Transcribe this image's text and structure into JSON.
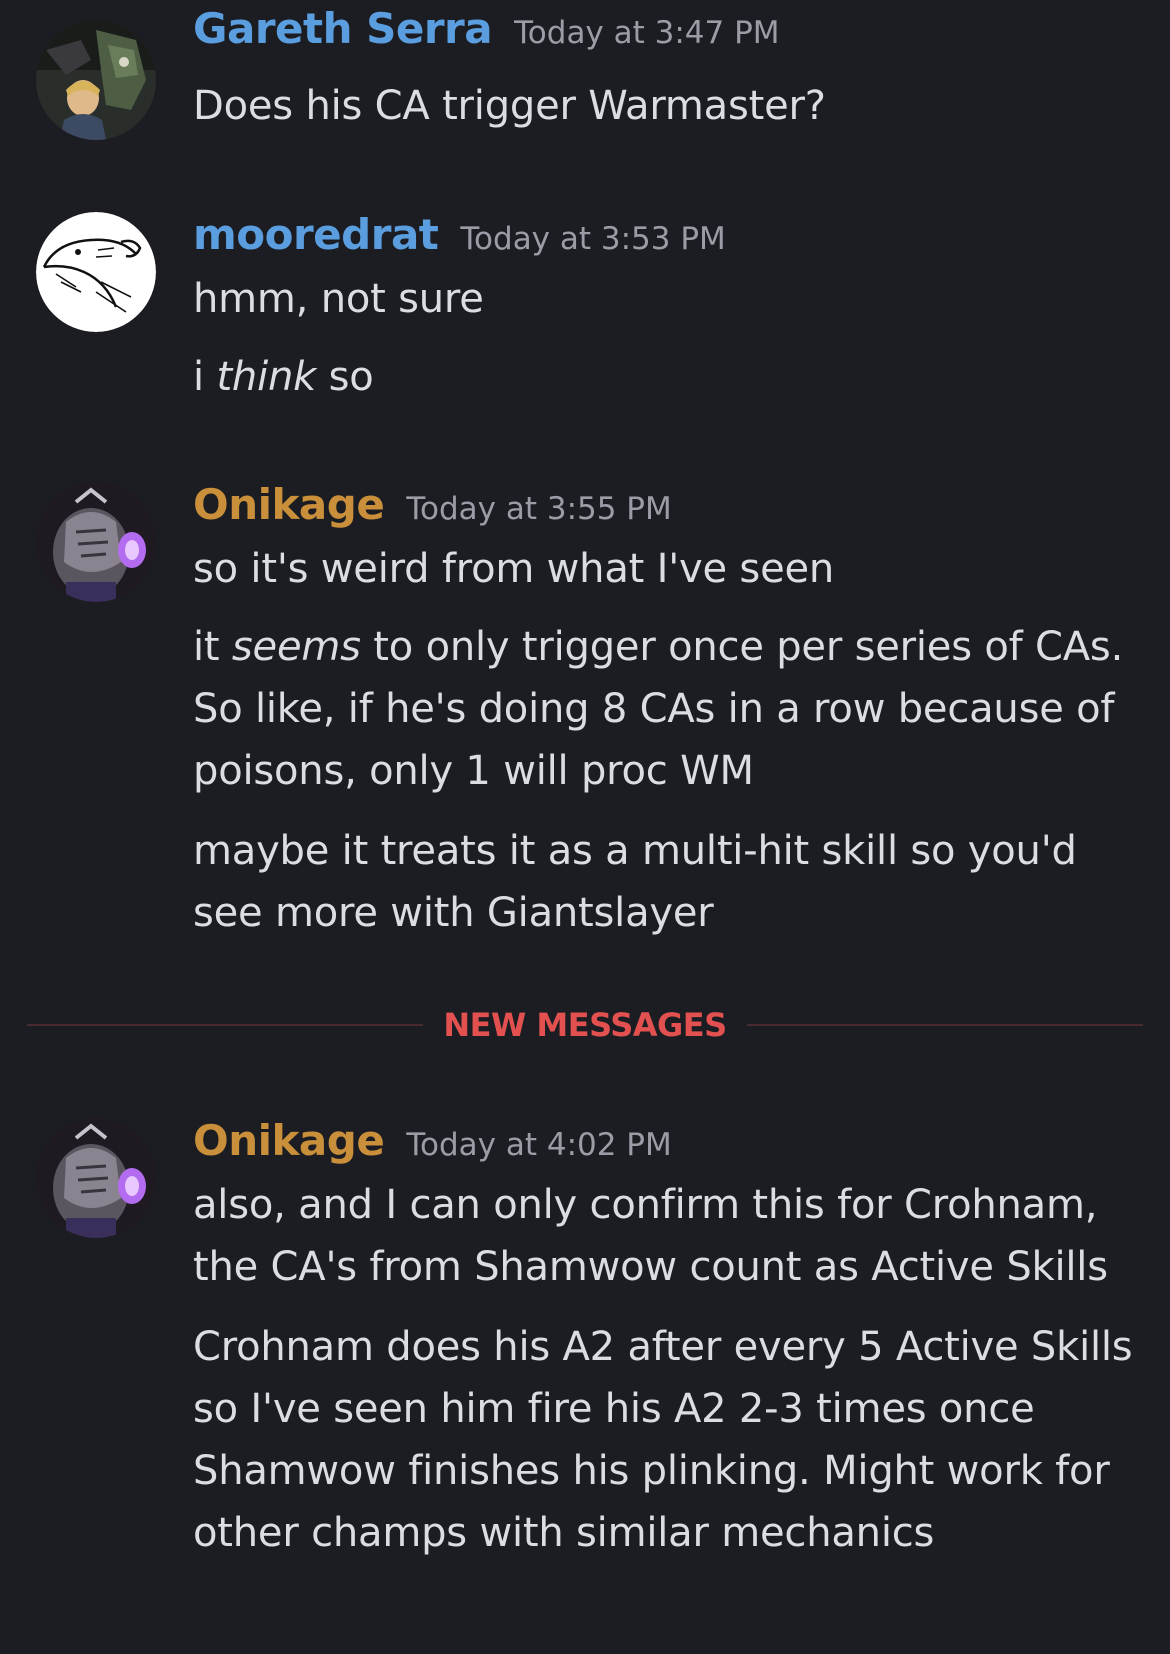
{
  "colors": {
    "background": "#1c1d22",
    "text": "#dbdee1",
    "timestamp": "#9a9da6",
    "new_messages": "#e2514f"
  },
  "messages": [
    {
      "username": "Gareth Serra",
      "username_color": "#5a9ee0",
      "timestamp": "Today at 3:47 PM",
      "avatar_icon": "mecha-avatar",
      "lines": [
        "Does his CA trigger Warmaster?"
      ]
    },
    {
      "username": "mooredrat",
      "username_color": "#5a9ee0",
      "timestamp": "Today at 3:53 PM",
      "avatar_icon": "rat-sketch-avatar",
      "lines": [
        "hmm, not sure",
        {
          "pre": "i ",
          "em": "think",
          "post": " so"
        }
      ]
    },
    {
      "username": "Onikage",
      "username_color": "#c98f3a",
      "timestamp": "Today at 3:55 PM",
      "avatar_icon": "warrior-avatar",
      "lines": [
        "so it's weird from what I've seen",
        {
          "pre": "it ",
          "em": "seems",
          "post": " to only trigger once per series of CAs. So like, if he's doing 8 CAs in a row because of poisons, only 1 will proc WM"
        },
        "maybe it treats it as a multi-hit skill so you'd see more with Giantslayer"
      ]
    },
    {
      "username": "Onikage",
      "username_color": "#c98f3a",
      "timestamp": "Today at 4:02 PM",
      "avatar_icon": "warrior-avatar",
      "lines": [
        "also, and I can only confirm this for Crohnam, the CA's from Shamwow count as Active Skills",
        "Crohnam does his A2 after every 5 Active Skills so I've seen him fire his A2 2-3 times once Shamwow finishes his plinking. Might work for other champs with similar mechanics"
      ]
    }
  ],
  "divider": {
    "label": "NEW MESSAGES"
  }
}
